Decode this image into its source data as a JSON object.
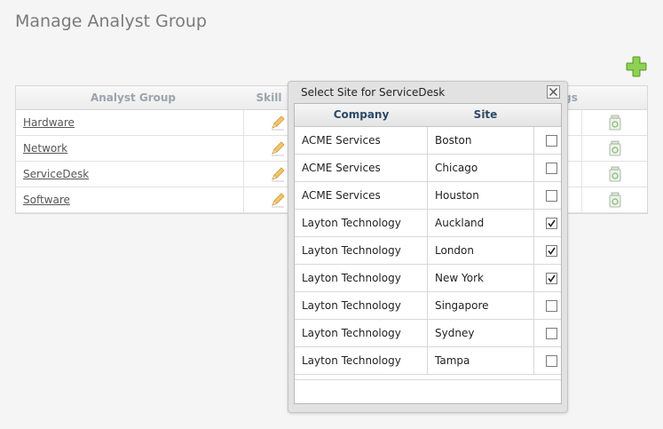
{
  "page": {
    "title": "Manage Analyst Group"
  },
  "toolbar": {
    "add_icon": "plus-icon"
  },
  "grid": {
    "columns": [
      "Analyst Group",
      "Skill",
      "gs"
    ],
    "rows": [
      {
        "name": "Hardware"
      },
      {
        "name": "Network"
      },
      {
        "name": "ServiceDesk"
      },
      {
        "name": "Software"
      }
    ]
  },
  "dialog": {
    "title": "Select Site for ServiceDesk",
    "columns": [
      "Company",
      "Site"
    ],
    "rows": [
      {
        "company": "ACME Services",
        "site": "Boston",
        "checked": false
      },
      {
        "company": "ACME Services",
        "site": "Chicago",
        "checked": false
      },
      {
        "company": "ACME Services",
        "site": "Houston",
        "checked": false
      },
      {
        "company": "Layton Technology",
        "site": "Auckland",
        "checked": true
      },
      {
        "company": "Layton Technology",
        "site": "London",
        "checked": true
      },
      {
        "company": "Layton Technology",
        "site": "New York",
        "checked": true
      },
      {
        "company": "Layton Technology",
        "site": "Singapore",
        "checked": false
      },
      {
        "company": "Layton Technology",
        "site": "Sydney",
        "checked": false
      },
      {
        "company": "Layton Technology",
        "site": "Tampa",
        "checked": false
      }
    ]
  },
  "colors": {
    "accent": "#7dc242",
    "header_text": "#2c4a66"
  }
}
